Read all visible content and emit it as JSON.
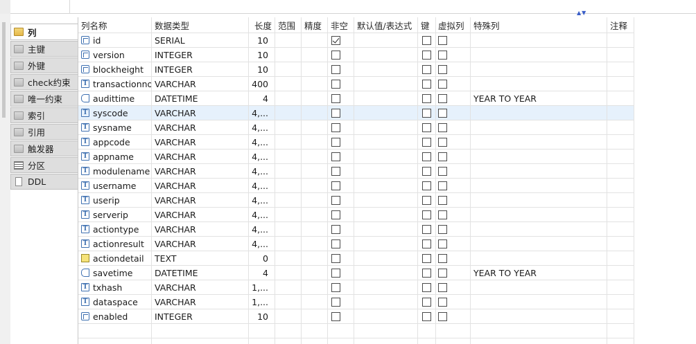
{
  "tabs": [
    {
      "label": "列",
      "icon": "folder-icon",
      "active": true
    },
    {
      "label": "主键",
      "icon": "folder-icon",
      "active": false
    },
    {
      "label": "外键",
      "icon": "folder-icon",
      "active": false
    },
    {
      "label": "check约束",
      "icon": "folder-icon",
      "active": false
    },
    {
      "label": "唯一约束",
      "icon": "folder-icon",
      "active": false
    },
    {
      "label": "索引",
      "icon": "folder-icon",
      "active": false
    },
    {
      "label": "引用",
      "icon": "folder-icon",
      "active": false
    },
    {
      "label": "触发器",
      "icon": "folder-icon",
      "active": false
    },
    {
      "label": "分区",
      "icon": "partition-icon",
      "active": false
    },
    {
      "label": "DDL",
      "icon": "document-icon",
      "active": false
    }
  ],
  "columns_header": {
    "name": "列名称",
    "type": "数据类型",
    "length": "长度",
    "range": "范围",
    "precision": "精度",
    "not_null": "非空",
    "default": "默认值/表达式",
    "key": "键",
    "virtual": "虚拟列",
    "special": "特殊列",
    "comment": "注释"
  },
  "rows": [
    {
      "name": "id",
      "type": "SERIAL",
      "length": "10",
      "not_null": true,
      "special": "",
      "icon": "integer-icon"
    },
    {
      "name": "version",
      "type": "INTEGER",
      "length": "10",
      "not_null": false,
      "special": "",
      "icon": "integer-icon"
    },
    {
      "name": "blockheight",
      "type": "INTEGER",
      "length": "10",
      "not_null": false,
      "special": "",
      "icon": "integer-icon"
    },
    {
      "name": "transactionno",
      "type": "VARCHAR",
      "length": "400",
      "not_null": false,
      "special": "",
      "icon": "text-icon"
    },
    {
      "name": "audittime",
      "type": "DATETIME",
      "length": "4",
      "not_null": false,
      "special": "YEAR TO YEAR",
      "icon": "datetime-icon"
    },
    {
      "name": "syscode",
      "type": "VARCHAR",
      "length": "4,...",
      "not_null": false,
      "special": "",
      "icon": "text-icon",
      "selected": true
    },
    {
      "name": "sysname",
      "type": "VARCHAR",
      "length": "4,...",
      "not_null": false,
      "special": "",
      "icon": "text-icon"
    },
    {
      "name": "appcode",
      "type": "VARCHAR",
      "length": "4,...",
      "not_null": false,
      "special": "",
      "icon": "text-icon"
    },
    {
      "name": "appname",
      "type": "VARCHAR",
      "length": "4,...",
      "not_null": false,
      "special": "",
      "icon": "text-icon"
    },
    {
      "name": "modulename",
      "type": "VARCHAR",
      "length": "4,...",
      "not_null": false,
      "special": "",
      "icon": "text-icon"
    },
    {
      "name": "username",
      "type": "VARCHAR",
      "length": "4,...",
      "not_null": false,
      "special": "",
      "icon": "text-icon"
    },
    {
      "name": "userip",
      "type": "VARCHAR",
      "length": "4,...",
      "not_null": false,
      "special": "",
      "icon": "text-icon"
    },
    {
      "name": "serverip",
      "type": "VARCHAR",
      "length": "4,...",
      "not_null": false,
      "special": "",
      "icon": "text-icon"
    },
    {
      "name": "actiontype",
      "type": "VARCHAR",
      "length": "4,...",
      "not_null": false,
      "special": "",
      "icon": "text-icon"
    },
    {
      "name": "actionresult",
      "type": "VARCHAR",
      "length": "4,...",
      "not_null": false,
      "special": "",
      "icon": "text-icon"
    },
    {
      "name": "actiondetail",
      "type": "TEXT",
      "length": "0",
      "not_null": false,
      "special": "",
      "icon": "blob-icon"
    },
    {
      "name": "savetime",
      "type": "DATETIME",
      "length": "4",
      "not_null": false,
      "special": "YEAR TO YEAR",
      "icon": "datetime-icon"
    },
    {
      "name": "txhash",
      "type": "VARCHAR",
      "length": "1,...",
      "not_null": false,
      "special": "",
      "icon": "text-icon"
    },
    {
      "name": "dataspace",
      "type": "VARCHAR",
      "length": "1,...",
      "not_null": false,
      "special": "",
      "icon": "text-icon"
    },
    {
      "name": "enabled",
      "type": "INTEGER",
      "length": "10",
      "not_null": false,
      "special": "",
      "icon": "integer-icon"
    }
  ],
  "colors": {
    "selected_row": "#e6f1fc",
    "grid_line": "#e2e2e2",
    "icon_blue": "#3d6fb0"
  }
}
